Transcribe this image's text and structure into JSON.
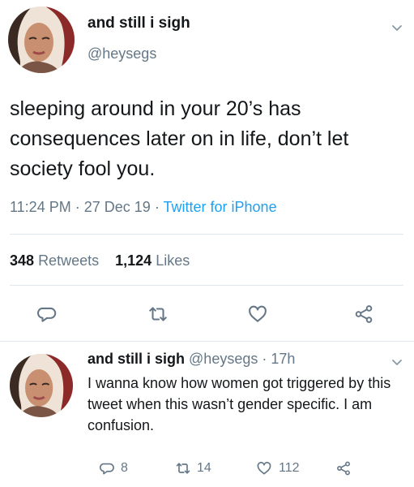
{
  "main_tweet": {
    "display_name": "and still i sigh",
    "handle": "@heysegs",
    "text": "sleeping around in your 20’s has consequences later on in life, don’t let society fool you.",
    "time": "11:24 PM",
    "date": "27 Dec 19",
    "client": "Twitter for iPhone",
    "sep": "·",
    "retweets_count": "348",
    "retweets_label": "Retweets",
    "likes_count": "1,124",
    "likes_label": "Likes"
  },
  "reply_tweet": {
    "display_name": "and still i sigh",
    "handle": "@heysegs",
    "sep": "·",
    "age": "17h",
    "text": "I wanna know how women got triggered by this tweet when this wasn’t gender specific. I am confusion.",
    "replies_count": "8",
    "retweets_count": "14",
    "likes_count": "112"
  },
  "colors": {
    "text": "#14171a",
    "muted": "#657786",
    "link": "#1da1f2",
    "divider": "#e1e8ed"
  },
  "icons": [
    "reply-icon",
    "retweet-icon",
    "like-icon",
    "share-icon",
    "chevron-down-icon"
  ]
}
